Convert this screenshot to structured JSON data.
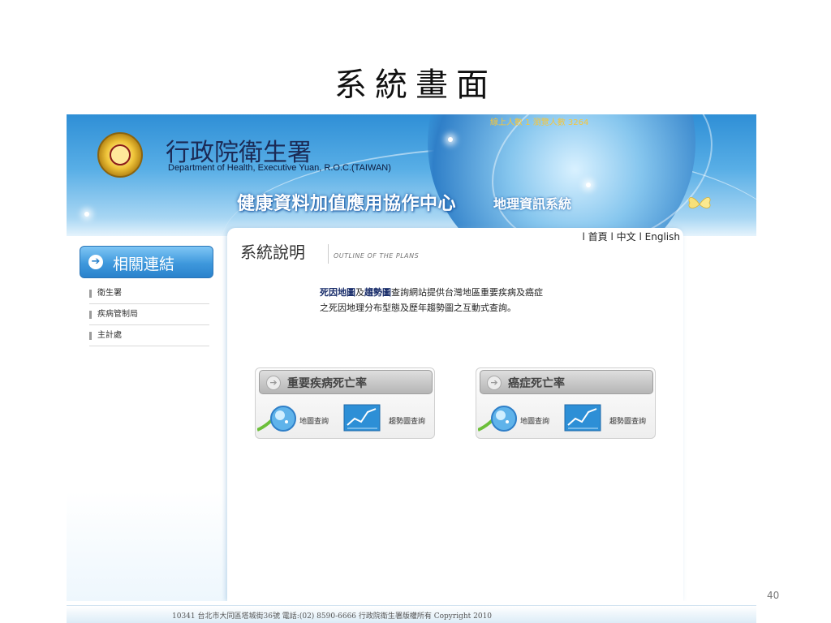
{
  "slide": {
    "title": "系統畫面",
    "page_number": "40"
  },
  "header": {
    "org_name": "行政院衛生署",
    "org_english": "Department of Health, Executive Yuan, R.O.C.(TAIWAN)",
    "center_title": "健康資料加值應用協作中心",
    "center_subtitle": "地理資訊系統",
    "visitor_counter": "線上人數  1   瀏覽人數  3264"
  },
  "topnav": {
    "home": "首頁",
    "chinese": "中文",
    "english": "English",
    "separator": "l"
  },
  "sidebar": {
    "heading": "相關連結",
    "items": [
      {
        "label": "衛生署"
      },
      {
        "label": "疾病管制局"
      },
      {
        "label": "主計處"
      }
    ]
  },
  "main": {
    "section_title": "系統說明",
    "section_subtitle": "OUTLINE OF THE PLANS",
    "desc_strong1": "死因地圖",
    "desc_join": "及",
    "desc_strong2": "趨勢圖",
    "desc_rest": "查詢網站提供台灣地區重要疾病及癌症",
    "desc_line2": "之死因地理分布型態及歷年趨勢圖之互動式查詢。",
    "cards": [
      {
        "title": "重要疾病死亡率",
        "map_label": "地圖查詢",
        "trend_label": "趨勢圖查詢"
      },
      {
        "title": "癌症死亡率",
        "map_label": "地圖查詢",
        "trend_label": "趨勢圖查詢"
      }
    ]
  },
  "footer": {
    "text": "10341   台北市大同區塔城街36號    電話:(02) 8590-6666  行政院衛生署版權所有 Copyright 2010"
  },
  "colors": {
    "banner_blue": "#2f8fd6",
    "title_white": "#ffffff",
    "sidebar_head": "#3e98dc"
  }
}
